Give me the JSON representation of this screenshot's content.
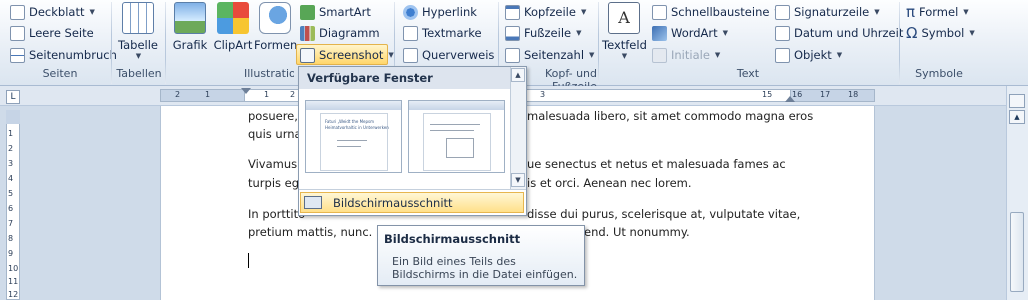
{
  "ribbon": {
    "seiten": {
      "items": [
        "Deckblatt",
        "Leere Seite",
        "Seitenumbruch"
      ],
      "label": "Seiten"
    },
    "tabellen": {
      "button": "Tabelle",
      "label": "Tabellen"
    },
    "illustrationen": {
      "big": [
        "Grafik",
        "ClipArt",
        "Formen"
      ],
      "small": [
        "SmartArt",
        "Diagramm",
        "Screenshot"
      ],
      "label": "Illustrationen"
    },
    "links": {
      "items": [
        "Hyperlink",
        "Textmarke",
        "Querverweis"
      ]
    },
    "kopf": {
      "items": [
        "Kopfzeile",
        "Fußzeile",
        "Seitenzahl"
      ],
      "label": "Kopf- und Fußzeile"
    },
    "text": {
      "textfeld": "Textfeld",
      "items": [
        "Schnellbausteine",
        "WordArt",
        "Initiale",
        "Signaturzeile",
        "Datum und Uhrzeit",
        "Objekt"
      ],
      "label": "Text"
    },
    "symbole": {
      "items": [
        "Formel",
        "Symbol"
      ],
      "label": "Symbole"
    }
  },
  "ruler": {
    "numbers": [
      "2",
      "1",
      "1",
      "2",
      "3",
      "15",
      "16",
      "17",
      "18"
    ],
    "vnumbers": [
      "1",
      "2",
      "3",
      "4",
      "5",
      "6",
      "7",
      "8",
      "9",
      "10",
      "11",
      "12"
    ]
  },
  "document": {
    "lines_left": [
      "posuere,",
      "quis urna",
      "Vivamus a",
      "turpis eget",
      "In porttito",
      "pretium mattis,  nunc. Ma"
    ],
    "lines_right": [
      "malesuada libero, sit amet commodo magna eros",
      "ue senectus et netus et malesuada fames ac",
      "is et orci. Aenean nec lorem.",
      "disse dui purus, scelerisque at, vulputate vitae,",
      "end. Ut nonummy."
    ]
  },
  "dropdown": {
    "header": "Verfügbare Fenster",
    "thumb_text": [
      "Faturi „Weidt the Mepsm",
      "Heimatvorhaltic in Unterwerken"
    ],
    "clip_item": "Bildschirmausschnitt"
  },
  "tooltip": {
    "title": "Bildschirmausschnitt",
    "body": "Ein Bild eines Teils des Bildschirms in die Datei einfügen."
  },
  "colors": {
    "ribbon_bg": "#dbe5f0",
    "highlight": "#ffd66b",
    "page_bg": "#cfdbe9"
  }
}
